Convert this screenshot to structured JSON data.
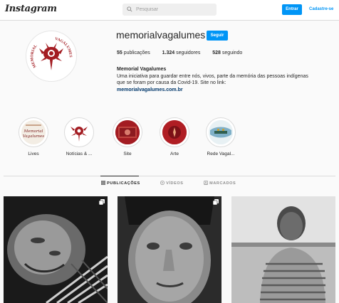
{
  "header": {
    "logo": "Instagram",
    "search_placeholder": "Pesquisar",
    "login_label": "Entrar",
    "signup_label": "Cadastre-se"
  },
  "profile": {
    "username": "memorialvagalumes",
    "follow_label": "Seguir",
    "posts_count": "55",
    "posts_label": "publicações",
    "followers_count": "1.324",
    "followers_label": "seguidores",
    "following_count": "528",
    "following_label": "seguindo",
    "full_name": "Memorial Vagalumes",
    "bio_line1": "Uma iniciativa para guardar entre nós, vivos, parte da memória das pessoas indígenas",
    "bio_line2": "que se foram por causa da Covid-19. Site no link:",
    "website": "memorialvagalumes.com.br",
    "avatar_text_left": "MEMORIAL",
    "avatar_text_right": "VAGALUMES"
  },
  "highlights": [
    {
      "label": "Lives",
      "cover_text_1": "Memorial",
      "cover_text_2": "Vagalumes"
    },
    {
      "label": "Notícias & ..."
    },
    {
      "label": "Site"
    },
    {
      "label": "Arte"
    },
    {
      "label": "Rede Vagal..."
    }
  ],
  "tabs": [
    {
      "label": "PUBLICAÇÕES",
      "active": true
    },
    {
      "label": "VÍDEOS",
      "active": false
    },
    {
      "label": "MARCADOS",
      "active": false
    }
  ],
  "colors": {
    "accent": "#0095f6",
    "brand_red": "#a31c22",
    "link": "#00376b"
  },
  "icons": [
    "search-icon",
    "grid-icon",
    "video-icon",
    "tag-icon",
    "carousel-icon"
  ]
}
